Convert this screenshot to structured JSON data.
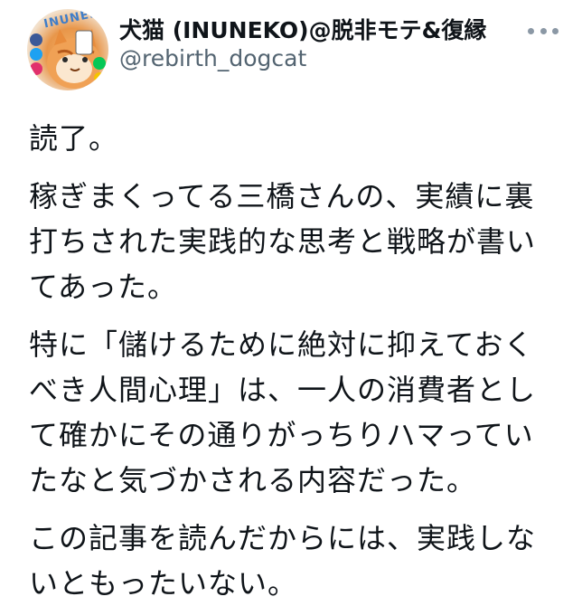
{
  "author": {
    "display_name": "犬猫 (INUNEKO)@脱非モテ&復縁",
    "handle": "@rebirth_dogcat",
    "avatar_text": "INUNEKO"
  },
  "tweet": {
    "paragraphs": [
      {
        "lines": [
          "読了。"
        ]
      },
      {
        "lines": [
          "稼ぎまくってる三橋さんの、実績に裏",
          "打ちされた実践的な思考と戦略が書い",
          "てあった。"
        ]
      },
      {
        "lines": [
          "特に「儲けるために絶対に抑えておく",
          "べき人間心理」は、一人の消費者とし",
          "て確かにその通りがっちりハマってい",
          "たなと気づかされる内容だった。"
        ]
      },
      {
        "lines": [
          "この記事を読んだからには、実践しな",
          "いともったいない。"
        ]
      }
    ]
  },
  "icons": {
    "more": "more-horizontal-icon"
  },
  "colors": {
    "text": "#0f1419",
    "secondary": "#536471",
    "background": "#ffffff"
  }
}
